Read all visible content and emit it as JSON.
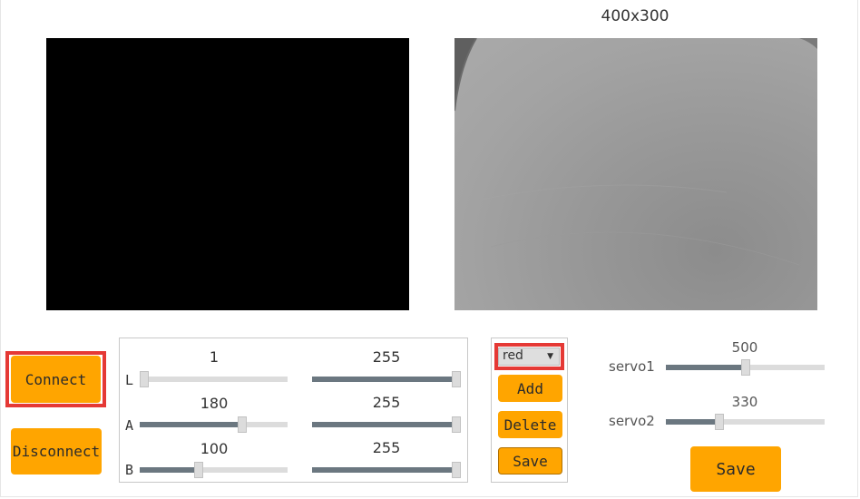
{
  "camera": {
    "resolution_label": "400x300"
  },
  "connection": {
    "connect_label": "Connect",
    "disconnect_label": "Disconnect"
  },
  "lab": {
    "L": {
      "axis": "L",
      "min": 1,
      "max": 255
    },
    "A": {
      "axis": "A",
      "min": 180,
      "max": 255
    },
    "B": {
      "axis": "B",
      "min": 100,
      "max": 255
    },
    "range": [
      0,
      255
    ]
  },
  "color": {
    "selected": "red",
    "add_label": "Add",
    "delete_label": "Delete",
    "save_label": "Save"
  },
  "servo": {
    "servo1": {
      "label": "servo1",
      "value": 500
    },
    "servo2": {
      "label": "servo2",
      "value": 330
    },
    "range": [
      0,
      1000
    ],
    "save_label": "Save"
  },
  "colors": {
    "button": "#ffa500",
    "highlight": "#e53935",
    "slider_fill": "#6b7780",
    "slider_track": "#dcdcdc"
  }
}
